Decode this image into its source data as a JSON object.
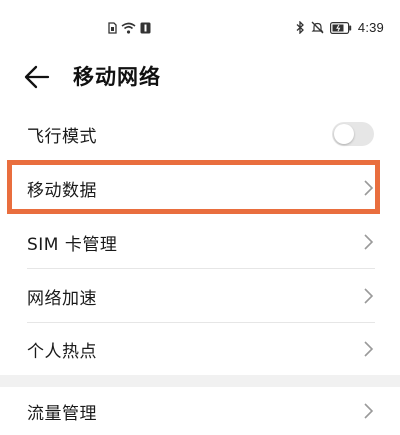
{
  "status_bar": {
    "time": "4:39",
    "icons_left": [
      "sim-icon",
      "wifi-icon",
      "notification-icon"
    ],
    "icons_right": [
      "bluetooth-icon",
      "mute-icon",
      "battery-icon"
    ]
  },
  "header": {
    "title": "移动网络",
    "back_icon": "back-arrow-icon"
  },
  "rows": {
    "airplane": {
      "label": "飞行模式",
      "toggle_on": false
    },
    "mobile_data": {
      "label": "移动数据"
    },
    "sim": {
      "label": "SIM 卡管理"
    },
    "acceleration": {
      "label": "网络加速"
    },
    "hotspot": {
      "label": "个人热点"
    },
    "traffic": {
      "label": "流量管理"
    }
  },
  "colors": {
    "highlight": "#e96e3e",
    "toggle_off": "#e6e6e6",
    "chevron": "#9a9a9a"
  }
}
